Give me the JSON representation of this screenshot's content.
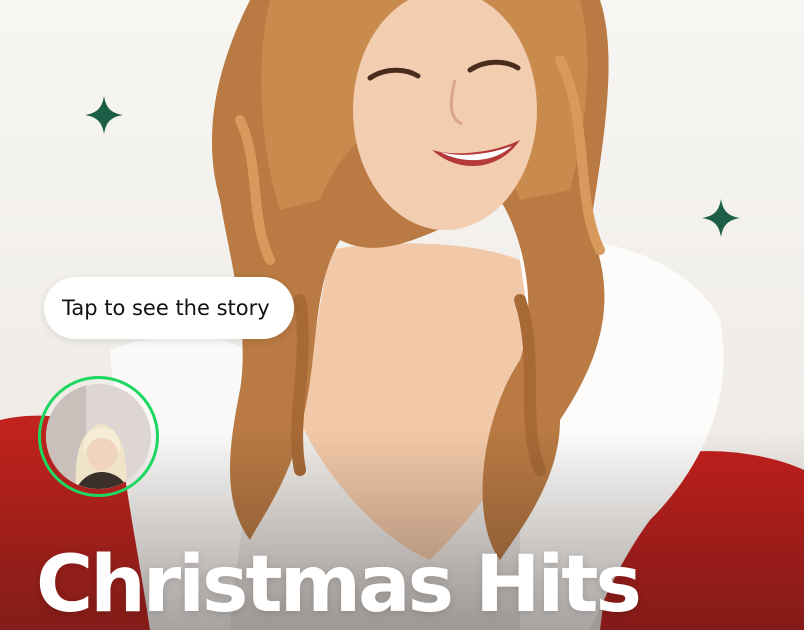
{
  "cover": {
    "title": "Christmas Hits",
    "image": "Cover photo: smiling woman with curly auburn hair in red Santa coat with white fur trim",
    "sparkle_color": "#1d5e46"
  },
  "story": {
    "tooltip": "Tap to see the story",
    "ring_color": "#1ed760",
    "avatar": "Profile picture of blonde woman"
  },
  "icons": [
    "sparkle-icon"
  ]
}
